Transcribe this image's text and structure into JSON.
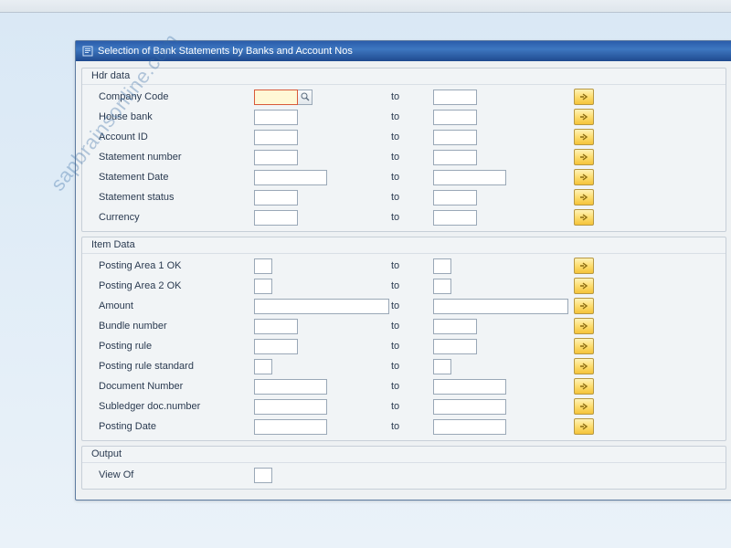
{
  "window": {
    "title": "Selection of Bank Statements by Banks and Account Nos"
  },
  "groups": {
    "hdr": {
      "title": "Hdr data"
    },
    "item": {
      "title": "Item Data"
    },
    "output": {
      "title": "Output"
    }
  },
  "labels": {
    "to": "to",
    "company_code": "Company Code",
    "house_bank": "House bank",
    "account_id": "Account ID",
    "statement_number": "Statement number",
    "statement_date": "Statement Date",
    "statement_status": "Statement status",
    "currency": "Currency",
    "posting_area_1": "Posting Area 1 OK",
    "posting_area_2": "Posting Area 2 OK",
    "amount": "Amount",
    "bundle_number": "Bundle number",
    "posting_rule": "Posting rule",
    "posting_rule_std": "Posting rule standard",
    "document_number": "Document Number",
    "subledger_doc": "Subledger doc.number",
    "posting_date": "Posting Date",
    "view_of": "View Of"
  },
  "values": {
    "company_code_from": "",
    "company_code_to": "",
    "house_bank_from": "",
    "house_bank_to": "",
    "account_id_from": "",
    "account_id_to": "",
    "statement_number_from": "",
    "statement_number_to": "",
    "statement_date_from": "",
    "statement_date_to": "",
    "statement_status_from": "",
    "statement_status_to": "",
    "currency_from": "",
    "currency_to": "",
    "posting_area_1_from": "",
    "posting_area_1_to": "",
    "posting_area_2_from": "",
    "posting_area_2_to": "",
    "amount_from": "",
    "amount_to": "",
    "bundle_number_from": "",
    "bundle_number_to": "",
    "posting_rule_from": "",
    "posting_rule_to": "",
    "posting_rule_std_from": "",
    "posting_rule_std_to": "",
    "document_number_from": "",
    "document_number_to": "",
    "subledger_doc_from": "",
    "subledger_doc_to": "",
    "posting_date_from": "",
    "posting_date_to": "",
    "view_of": ""
  },
  "watermark": "sapbrainsonline.com"
}
